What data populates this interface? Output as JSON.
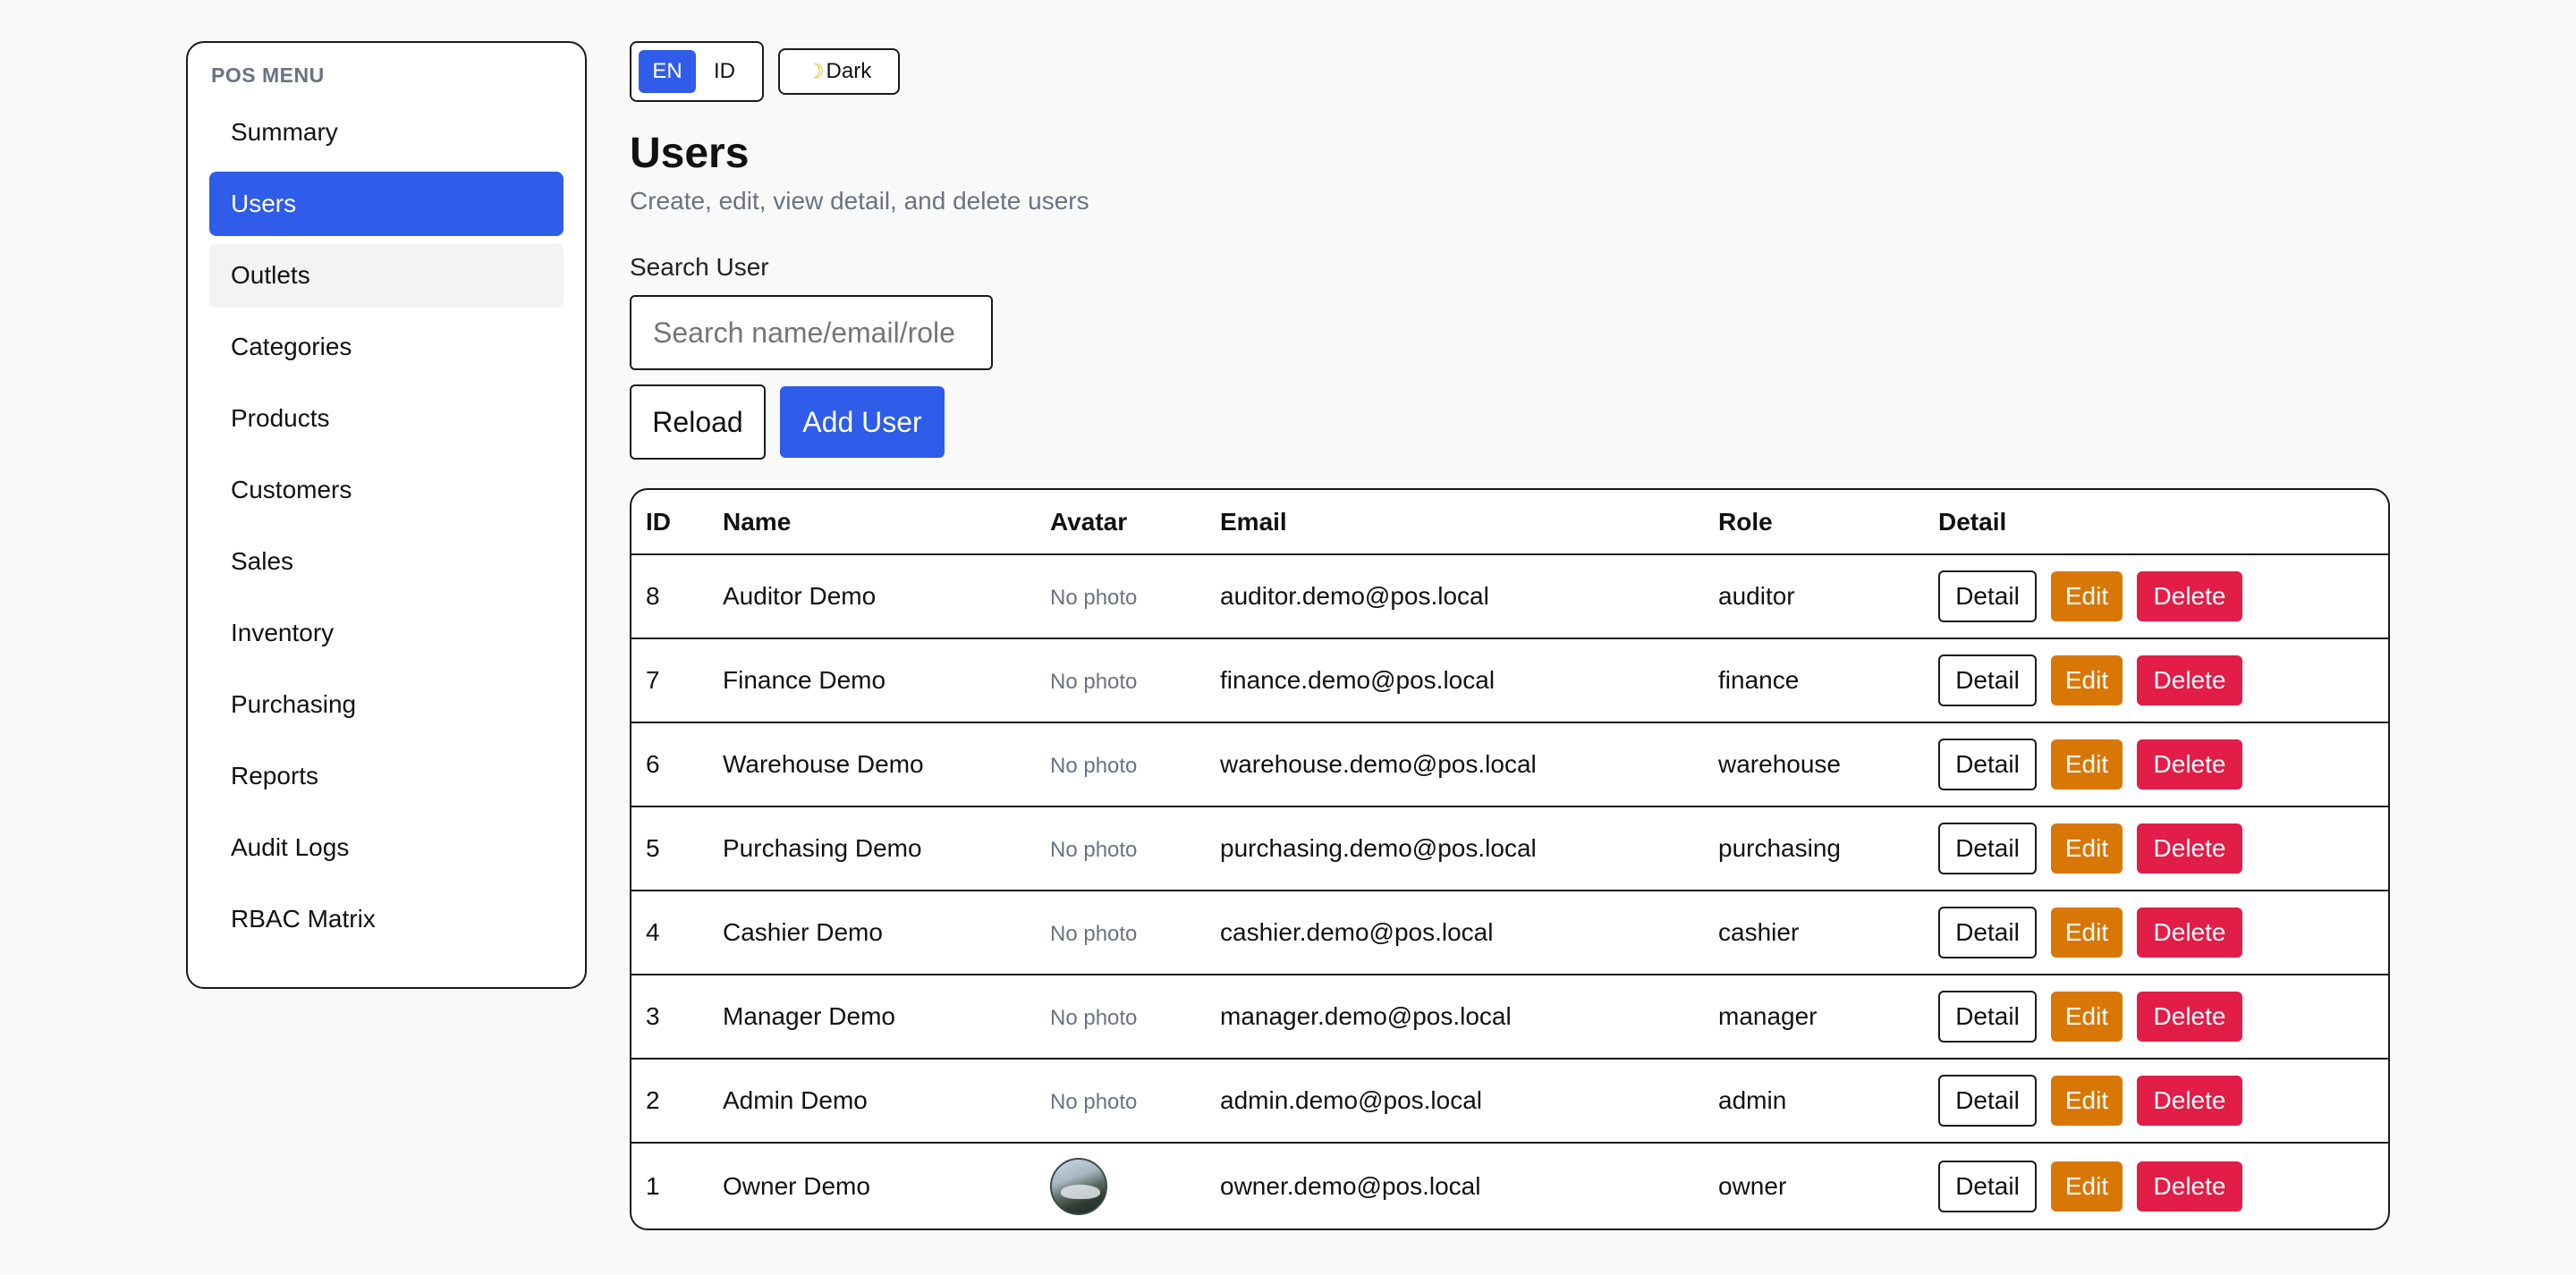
{
  "sidebar": {
    "title": "POS MENU",
    "items": [
      {
        "label": "Summary"
      },
      {
        "label": "Users"
      },
      {
        "label": "Outlets"
      },
      {
        "label": "Categories"
      },
      {
        "label": "Products"
      },
      {
        "label": "Customers"
      },
      {
        "label": "Sales"
      },
      {
        "label": "Inventory"
      },
      {
        "label": "Purchasing"
      },
      {
        "label": "Reports"
      },
      {
        "label": "Audit Logs"
      },
      {
        "label": "RBAC Matrix"
      }
    ],
    "active_item": "Users",
    "hover_item": "Outlets"
  },
  "topbar": {
    "lang_en": "EN",
    "lang_id": "ID",
    "active_lang": "EN",
    "dark_label": "Dark",
    "dark_icon": "moon-icon"
  },
  "page": {
    "title": "Users",
    "subtitle": "Create, edit, view detail, and delete users"
  },
  "search": {
    "label": "Search User",
    "placeholder": "Search name/email/role",
    "value": ""
  },
  "actions": {
    "reload": "Reload",
    "add_user": "Add User"
  },
  "table": {
    "headers": {
      "id": "ID",
      "name": "Name",
      "avatar": "Avatar",
      "email": "Email",
      "role": "Role",
      "detail": "Detail"
    },
    "no_photo_text": "No photo",
    "detail_label": "Detail",
    "edit_label": "Edit",
    "delete_label": "Delete",
    "rows": [
      {
        "id": "8",
        "name": "Auditor Demo",
        "avatar": "No photo",
        "email": "auditor.demo@pos.local",
        "role": "auditor"
      },
      {
        "id": "7",
        "name": "Finance Demo",
        "avatar": "No photo",
        "email": "finance.demo@pos.local",
        "role": "finance"
      },
      {
        "id": "6",
        "name": "Warehouse Demo",
        "avatar": "No photo",
        "email": "warehouse.demo@pos.local",
        "role": "warehouse"
      },
      {
        "id": "5",
        "name": "Purchasing Demo",
        "avatar": "No photo",
        "email": "purchasing.demo@pos.local",
        "role": "purchasing"
      },
      {
        "id": "4",
        "name": "Cashier Demo",
        "avatar": "No photo",
        "email": "cashier.demo@pos.local",
        "role": "cashier"
      },
      {
        "id": "3",
        "name": "Manager Demo",
        "avatar": "No photo",
        "email": "manager.demo@pos.local",
        "role": "manager"
      },
      {
        "id": "2",
        "name": "Admin Demo",
        "avatar": "No photo",
        "email": "admin.demo@pos.local",
        "role": "admin"
      },
      {
        "id": "1",
        "name": "Owner Demo",
        "avatar": "photo",
        "email": "owner.demo@pos.local",
        "role": "owner"
      }
    ]
  },
  "colors": {
    "primary": "#2f5ce8",
    "edit": "#d97706",
    "delete": "#e11d48",
    "background": "#f9f9f9"
  }
}
